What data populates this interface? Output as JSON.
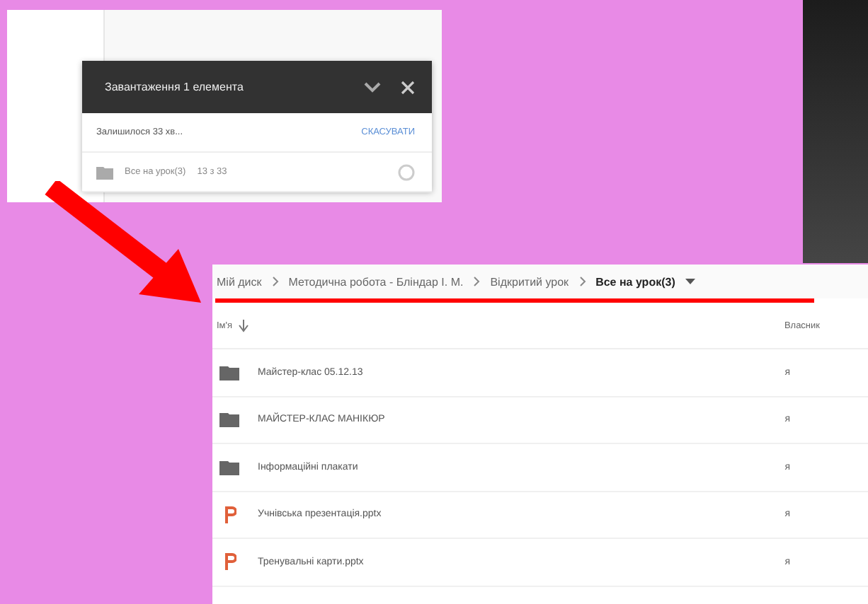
{
  "upload_panel": {
    "title": "Завантаження 1 елемента",
    "status": "Залишилося 33 хв...",
    "cancel": "СКАСУВАТИ",
    "item": {
      "name": "Все на урок(3)",
      "progress": "13 з 33"
    }
  },
  "drive": {
    "breadcrumbs": [
      {
        "label": "Мій диск",
        "current": false
      },
      {
        "label": "Методична робота - Бліндар І. М.",
        "current": false
      },
      {
        "label": "Відкритий урок",
        "current": false
      },
      {
        "label": "Все на урок(3)",
        "current": true
      }
    ],
    "columns": [
      "Ім'я",
      "Власник"
    ],
    "rows": [
      {
        "kind": "folder",
        "name": "Майстер-клас 05.12.13",
        "owner": "я"
      },
      {
        "kind": "folder",
        "name": "МАЙСТЕР-КЛАС МАНІКЮР",
        "owner": "я"
      },
      {
        "kind": "folder",
        "name": "Інформаційні плакати",
        "owner": "я"
      },
      {
        "kind": "slides",
        "name": "Учнівська презентація.pptx",
        "owner": "я"
      },
      {
        "kind": "slides",
        "name": "Тренувальні карти.pptx",
        "owner": "я"
      }
    ]
  }
}
